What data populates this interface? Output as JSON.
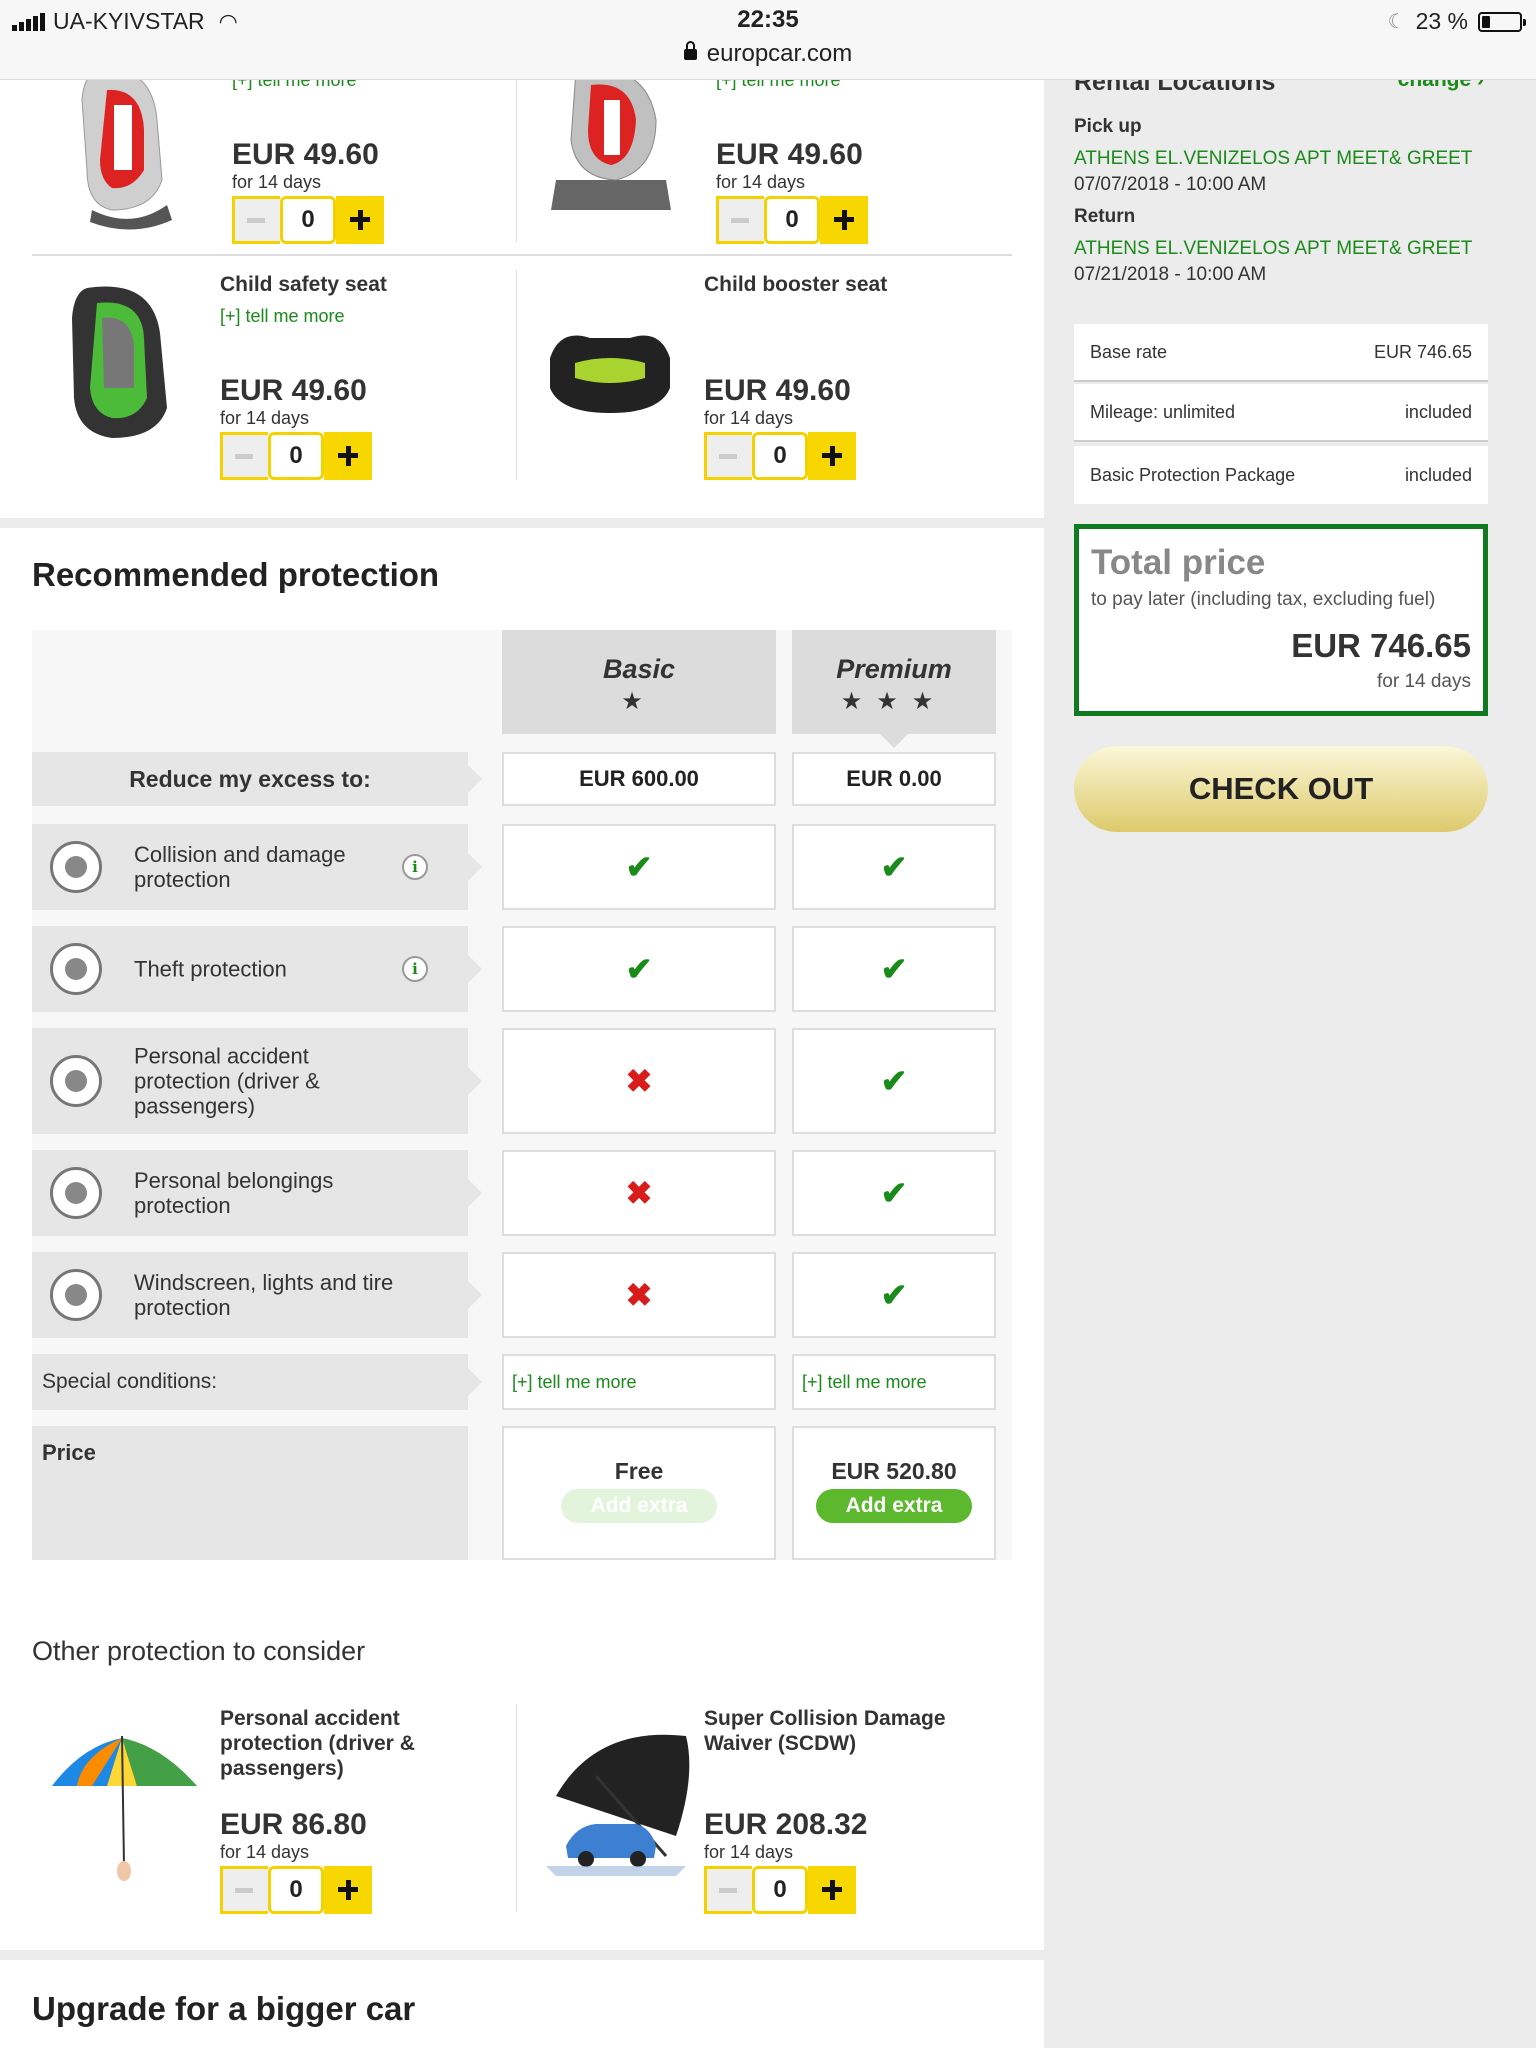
{
  "status_bar": {
    "carrier": "UA-KYIVSTAR",
    "time": "22:35",
    "url": "europcar.com",
    "battery": "23 %",
    "battery_level": 0.23
  },
  "extras": [
    {
      "name": "",
      "more": "[+] tell me more",
      "price": "EUR 49.60",
      "period": "for 14 days",
      "qty": "0"
    },
    {
      "name": "",
      "more": "[+] tell me more",
      "price": "EUR 49.60",
      "period": "for 14 days",
      "qty": "0"
    },
    {
      "name": "Child safety seat",
      "more": "[+] tell me more",
      "price": "EUR 49.60",
      "period": "for 14 days",
      "qty": "0"
    },
    {
      "name": "Child booster seat",
      "more": "",
      "price": "EUR 49.60",
      "period": "for 14 days",
      "qty": "0"
    }
  ],
  "protection": {
    "title": "Recommended protection",
    "plans": [
      {
        "name": "Basic",
        "stars": "★",
        "excess": "EUR 600.00",
        "special": "[+] tell me more",
        "price": "Free",
        "button": "Add extra"
      },
      {
        "name": "Premium",
        "stars": "★★★",
        "excess": "EUR 0.00",
        "special": "[+] tell me more",
        "price": "EUR 520.80",
        "button": "Add extra"
      }
    ],
    "excess_label": "Reduce my excess to:",
    "rows": [
      {
        "label": "Collision and damage protection",
        "icon": "car-damage-icon",
        "info": true,
        "basic": "check",
        "premium": "check"
      },
      {
        "label": "Theft protection",
        "icon": "thief-icon",
        "info": true,
        "basic": "check",
        "premium": "check"
      },
      {
        "label": "Personal accident protection (driver & passengers)",
        "icon": "seatbelt-icon",
        "info": false,
        "basic": "cross",
        "premium": "check"
      },
      {
        "label": "Personal belongings protection",
        "icon": "suitcase-icon",
        "info": false,
        "basic": "cross",
        "premium": "check"
      },
      {
        "label": "Windscreen, lights and tire protection",
        "icon": "tire-icon",
        "info": false,
        "basic": "cross",
        "premium": "check"
      }
    ],
    "special_label": "Special conditions:",
    "price_label": "Price",
    "info_glyph": "i",
    "check_glyph": "✔",
    "cross_glyph": "✖"
  },
  "other": {
    "title": "Other protection to consider",
    "items": [
      {
        "name": "Personal accident protection (driver & passengers)",
        "price": "EUR 86.80",
        "period": "for 14 days",
        "qty": "0"
      },
      {
        "name": "Super Collision Damage Waiver (SCDW)",
        "price": "EUR 208.32",
        "period": "for 14 days",
        "qty": "0"
      }
    ]
  },
  "upgrade": {
    "title": "Upgrade for a bigger car"
  },
  "sidebar": {
    "title": "Rental Locations",
    "change": "change ›",
    "pickup_label": "Pick up",
    "pickup_location": "ATHENS EL.VENIZELOS APT MEET& GREET",
    "pickup_datetime": "07/07/2018 - 10:00 AM",
    "return_label": "Return",
    "return_location": "ATHENS EL.VENIZELOS APT MEET& GREET",
    "return_datetime": "07/21/2018 - 10:00 AM",
    "rates": [
      {
        "label": "Base rate",
        "value": "EUR 746.65"
      },
      {
        "label": "Mileage: unlimited",
        "value": "included"
      },
      {
        "label": "Basic Protection Package",
        "value": "included"
      }
    ],
    "total_title": "Total price",
    "total_note": "to pay later (including tax, excluding fuel)",
    "total_amount": "EUR 746.65",
    "total_period": "for 14 days",
    "checkout": "CHECK OUT"
  },
  "colors": {
    "accent_green": "#1a8a1a",
    "stepper_yellow": "#f8d600",
    "total_border": "#0f7a1f",
    "add_extra": "#5cb82c"
  }
}
